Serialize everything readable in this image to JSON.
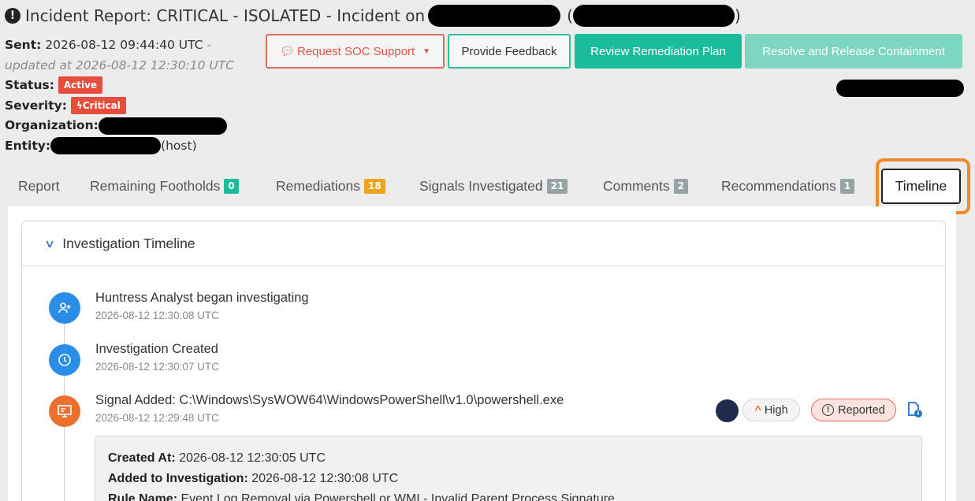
{
  "header": {
    "title": "Incident Report: CRITICAL - ISOLATED - Incident on",
    "paren_open": "(",
    "paren_close": ")"
  },
  "meta": {
    "sent_label": "Sent:",
    "sent_value": "2026-08-12 09:44:40 UTC",
    "sent_dash": " -",
    "updated_text": "updated at 2026-08-12 12:30:10 UTC",
    "status_label": "Status:",
    "status_value": "Active",
    "severity_label": "Severity:",
    "severity_value": "Critical",
    "organization_label": "Organization:",
    "entity_label": "Entity:",
    "entity_suffix": "(host)"
  },
  "actions": {
    "soc_support": "Request SOC Support",
    "feedback": "Provide Feedback",
    "review": "Review Remediation Plan",
    "resolve": "Resolve and Release Containment"
  },
  "tabs": [
    {
      "label": "Report"
    },
    {
      "label": "Remaining Footholds",
      "count": "0",
      "color": "#1abc9c"
    },
    {
      "label": "Remediations",
      "count": "18",
      "color": "#f0a31c"
    },
    {
      "label": "Signals Investigated",
      "count": "21",
      "color": "#95a5a6"
    },
    {
      "label": "Comments",
      "count": "2",
      "color": "#95a5a6"
    },
    {
      "label": "Recommendations",
      "count": "1",
      "color": "#95a5a6"
    },
    {
      "label": "Timeline"
    }
  ],
  "timeline": {
    "heading": "Investigation Timeline",
    "events": [
      {
        "title": "Huntress Analyst began investigating",
        "time": "2026-08-12 12:30:08 UTC",
        "icon": "user-plus-icon"
      },
      {
        "title": "Investigation Created",
        "time": "2026-08-12 12:30:07 UTC",
        "icon": "clock-icon"
      },
      {
        "title": "Signal Added: C:\\Windows\\SysWOW64\\WindowsPowerShell\\v1.0\\powershell.exe",
        "time": "2026-08-12 12:29:48 UTC",
        "icon": "monitor-icon"
      }
    ],
    "signal_badges": {
      "severity": "High",
      "state": "Reported"
    },
    "detail": {
      "created_label": "Created At:",
      "created_value": "2026-08-12 12:30:05 UTC",
      "added_label": "Added to Investigation:",
      "added_value": "2026-08-12 12:30:08 UTC",
      "rule_label": "Rule Name:",
      "rule_value": "Event Log Removal via Powershell or WMI - Invalid Parent Process Signature"
    }
  },
  "colors": {
    "accent": "#1abc9c",
    "danger": "#e74c3c",
    "highlight": "#f08a2c",
    "timeline_blue": "#2a8ee8",
    "timeline_orange": "#e9702d"
  }
}
